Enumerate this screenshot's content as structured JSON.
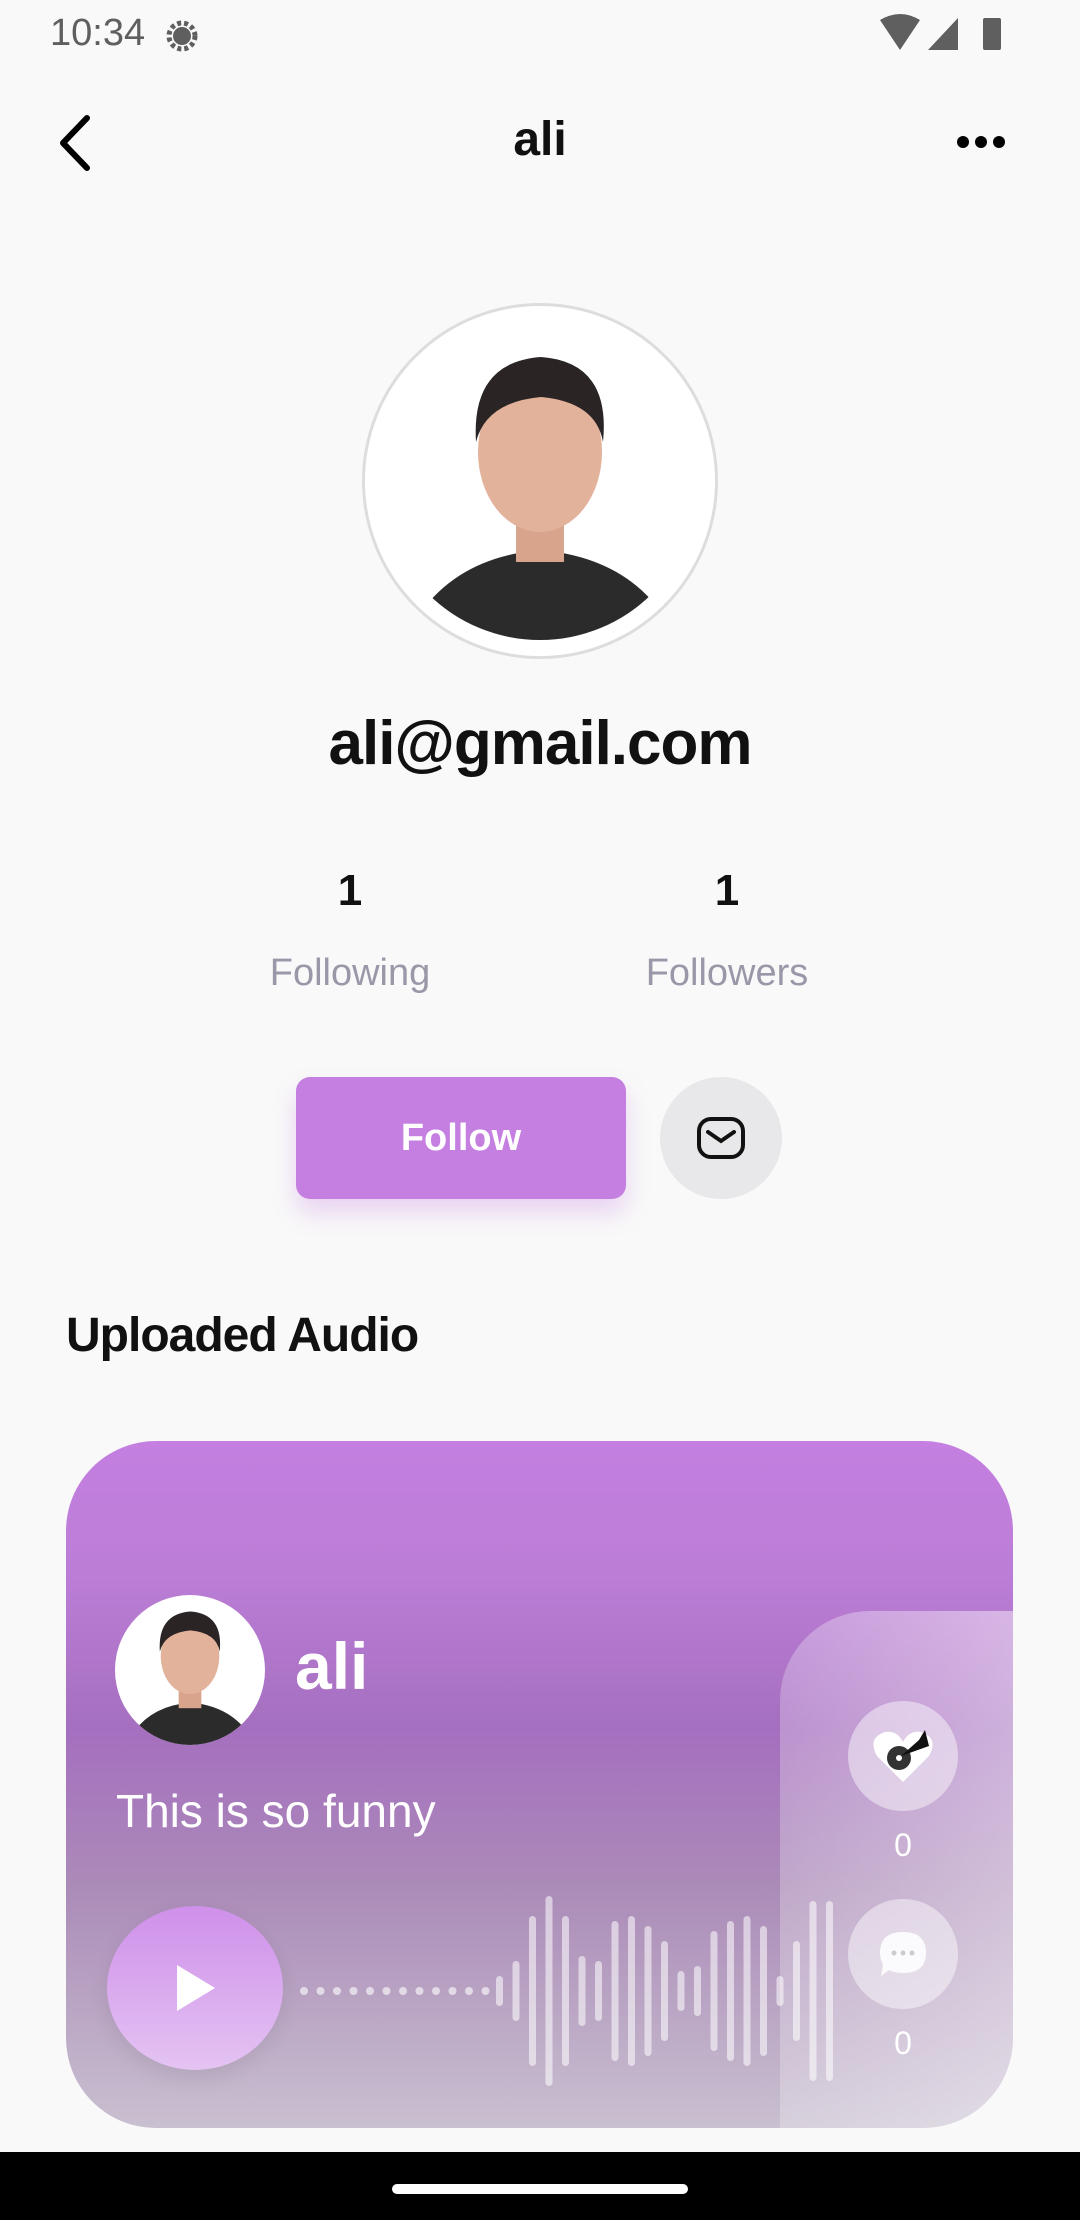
{
  "status_bar": {
    "time": "10:34"
  },
  "header": {
    "title": "ali"
  },
  "profile": {
    "email": "ali@gmail.com",
    "following_count": "1",
    "following_label": "Following",
    "followers_count": "1",
    "followers_label": "Followers",
    "follow_label": "Follow"
  },
  "section_title": "Uploaded Audio",
  "audio_card": {
    "username": "ali",
    "caption": "This is so funny",
    "likes": "0",
    "comments": "0"
  },
  "colors": {
    "accent": "#c47fe0"
  }
}
